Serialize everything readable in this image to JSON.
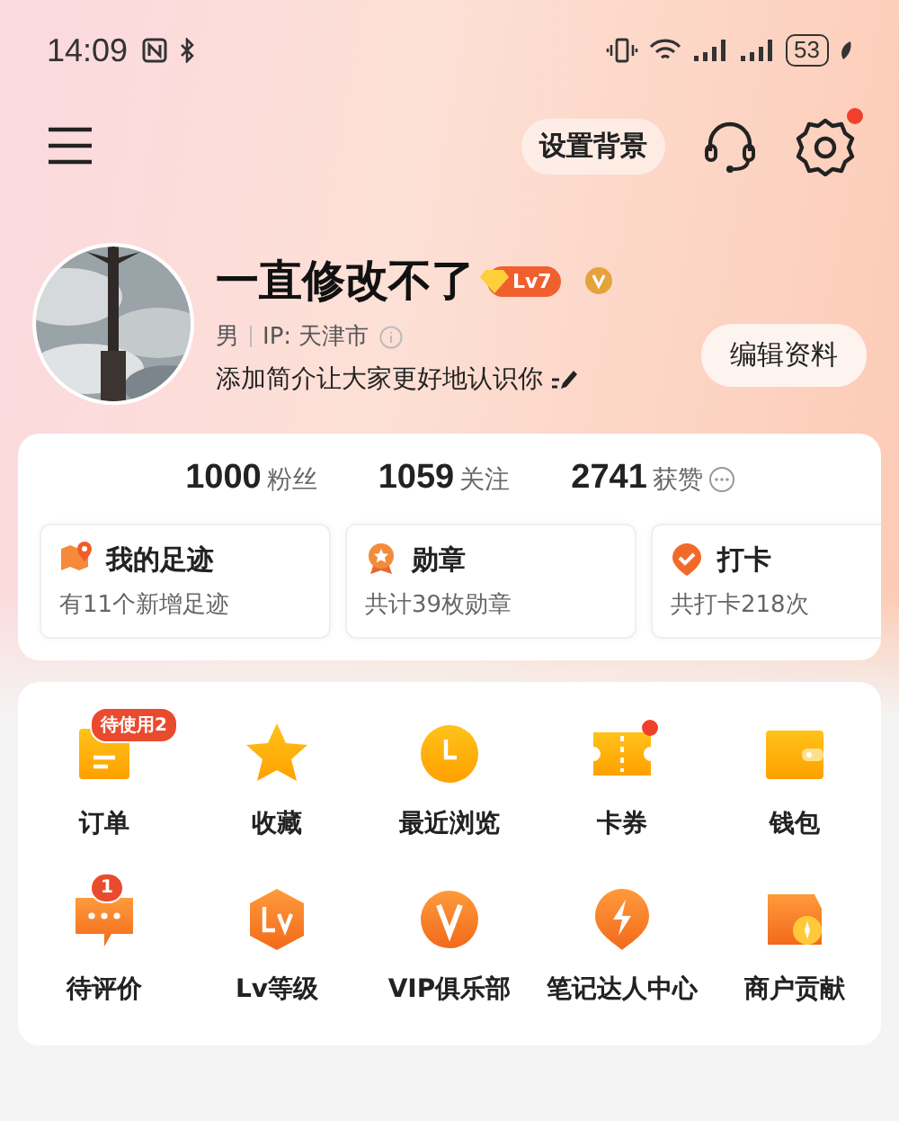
{
  "status_bar": {
    "time": "14:09",
    "battery": "53"
  },
  "header": {
    "background_button": "设置背景",
    "settings_dot": true
  },
  "profile": {
    "name": "一直修改不了",
    "level": "Lv7",
    "verified": true,
    "gender": "男",
    "ip": "IP: 天津市",
    "bio": "添加简介让大家更好地认识你",
    "edit_button": "编辑资料"
  },
  "stats": [
    {
      "value": "1000",
      "label": "粉丝"
    },
    {
      "value": "1059",
      "label": "关注"
    },
    {
      "value": "2741",
      "label": "获赞",
      "info": true
    }
  ],
  "shortcuts": [
    {
      "kind": "map",
      "title": "我的足迹",
      "subtitle": "有11个新增足迹"
    },
    {
      "kind": "medal",
      "title": "勋章",
      "subtitle": "共计39枚勋章"
    },
    {
      "kind": "checkin",
      "title": "打卡",
      "subtitle": "共打卡218次"
    }
  ],
  "grid": [
    {
      "kind": "order",
      "label": "订单",
      "badge": "待使用2"
    },
    {
      "kind": "star",
      "label": "收藏"
    },
    {
      "kind": "clock",
      "label": "最近浏览"
    },
    {
      "kind": "ticket",
      "label": "卡券",
      "dot": true
    },
    {
      "kind": "wallet",
      "label": "钱包"
    },
    {
      "kind": "comment",
      "label": "待评价",
      "badge": "1"
    },
    {
      "kind": "level",
      "label": "Lv等级"
    },
    {
      "kind": "vip",
      "label": "VIP俱乐部"
    },
    {
      "kind": "bolt",
      "label": "笔记达人中心"
    },
    {
      "kind": "shop",
      "label": "商户贡献"
    }
  ]
}
